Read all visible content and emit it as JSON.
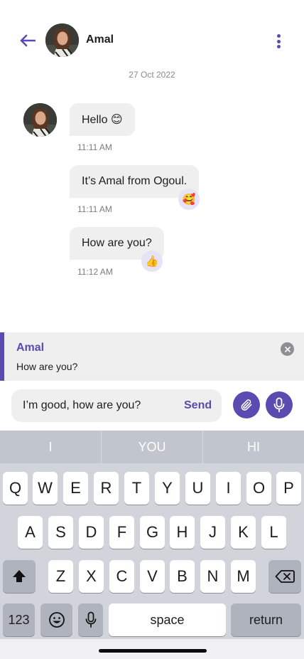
{
  "header": {
    "contact_name": "Amal",
    "back_icon": "arrow-left-icon",
    "menu_icon": "more-vertical-icon",
    "accent_color": "#5b4bb0"
  },
  "conversation": {
    "date": "27 Oct 2022",
    "messages": [
      {
        "text": "Hello 😊",
        "time": "11:11 AM",
        "reaction": ""
      },
      {
        "text": "It’s Amal from Ogoul.",
        "time": "11:11 AM",
        "reaction": "🥰"
      },
      {
        "text": "How are you?",
        "time": "11:12 AM",
        "reaction": "👍"
      }
    ]
  },
  "reply_preview": {
    "name": "Amal",
    "text": "How are you?"
  },
  "composer": {
    "value": "I’m good, how are you?",
    "send_label": "Send",
    "attach_icon": "paperclip-icon",
    "mic_icon": "microphone-icon"
  },
  "keyboard": {
    "suggestions": [
      "I",
      "YOU",
      "HI"
    ],
    "row1": [
      "Q",
      "W",
      "E",
      "R",
      "T",
      "Y",
      "U",
      "I",
      "O",
      "P"
    ],
    "row2": [
      "A",
      "S",
      "D",
      "F",
      "G",
      "H",
      "J",
      "K",
      "L"
    ],
    "row3": [
      "Z",
      "X",
      "C",
      "V",
      "B",
      "N",
      "M"
    ],
    "numbers_label": "123",
    "space_label": "space",
    "return_label": "return"
  }
}
